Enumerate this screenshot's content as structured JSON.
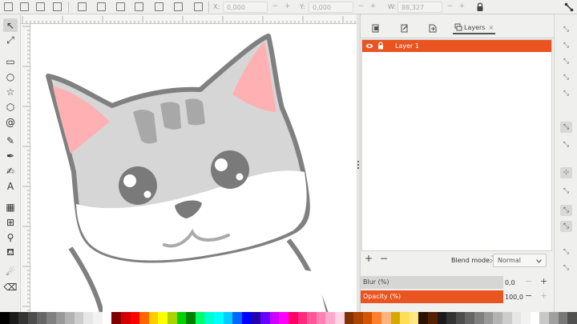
{
  "toolbar": {
    "x_label": "X:",
    "x_value": "0,000",
    "y_label": "Y:",
    "y_value": "0,000",
    "w_label": "W:",
    "w_value": "88,327",
    "minus": "−",
    "plus": "+"
  },
  "tools": [
    {
      "name": "selector-tool",
      "glyph": "↖"
    },
    {
      "name": "node-tool",
      "glyph": "⤢"
    },
    {
      "name": "rectangle-tool",
      "glyph": "▭"
    },
    {
      "name": "ellipse-tool",
      "glyph": "○"
    },
    {
      "name": "star-tool",
      "glyph": "☆"
    },
    {
      "name": "3d-box-tool",
      "glyph": "⬡"
    },
    {
      "name": "spiral-tool",
      "glyph": "@"
    },
    {
      "name": "pencil-tool",
      "glyph": "✎"
    },
    {
      "name": "pen-tool",
      "glyph": "✒"
    },
    {
      "name": "calligraphy-tool",
      "glyph": "✍"
    },
    {
      "name": "text-tool",
      "glyph": "A"
    },
    {
      "name": "gradient-tool",
      "glyph": "▦"
    },
    {
      "name": "mesh-tool",
      "glyph": "⊞"
    },
    {
      "name": "dropper-tool",
      "glyph": "⚲"
    },
    {
      "name": "paint-bucket-tool",
      "glyph": "⛾"
    },
    {
      "name": "tweak-tool",
      "glyph": "☄"
    },
    {
      "name": "eraser-tool",
      "glyph": "⌫"
    }
  ],
  "panel": {
    "tab_layers": "Layers",
    "tab_close": "×",
    "layer_name": "Layer 1",
    "add": "+",
    "remove": "−",
    "blend_label": "Blend mode:",
    "blend_value": "Normal",
    "blur_label": "Blur (%)",
    "blur_value": "0,0",
    "opacity_label": "Opacity (%)",
    "opacity_value": "100,0",
    "minus": "−",
    "plus": "+"
  },
  "colors": {
    "accent": "#e95420",
    "cat_outline": "#808080",
    "cat_fur": "#d4d4d4",
    "cat_ear": "#ffb0b3"
  },
  "palette": [
    "#000000",
    "#1a1a1a",
    "#333333",
    "#4d4d4d",
    "#666666",
    "#808080",
    "#999999",
    "#b3b3b3",
    "#cccccc",
    "#e6e6e6",
    "#f2f2f2",
    "#ffffff",
    "#800000",
    "#d40000",
    "#ff0000",
    "#ff6600",
    "#ffcc00",
    "#ffff00",
    "#aad400",
    "#00d400",
    "#008000",
    "#00ff66",
    "#00ffcc",
    "#00ffff",
    "#00ccff",
    "#0066ff",
    "#0000ff",
    "#2200aa",
    "#6600ff",
    "#cc00ff",
    "#ff00ff",
    "#ff0066",
    "#ff2a7f",
    "#ff5599",
    "#ff80b2",
    "#ffaacc",
    "#ffd5e5",
    "#803300",
    "#aa4400",
    "#d45500",
    "#ff7f2a",
    "#ffb380",
    "#d4aa00",
    "#ffdd55",
    "#ffe680",
    "#2b1100",
    "#552200",
    "#1a1a1a",
    "#333333",
    "#4d4d4d",
    "#666666",
    "#808080",
    "#999999",
    "#b3b3b3",
    "#cccccc",
    "#e6e6e6",
    "#f2f2f2",
    "#ffffff",
    "#c8c8c8",
    "#a0a0a0",
    "#787878",
    "#505050"
  ]
}
